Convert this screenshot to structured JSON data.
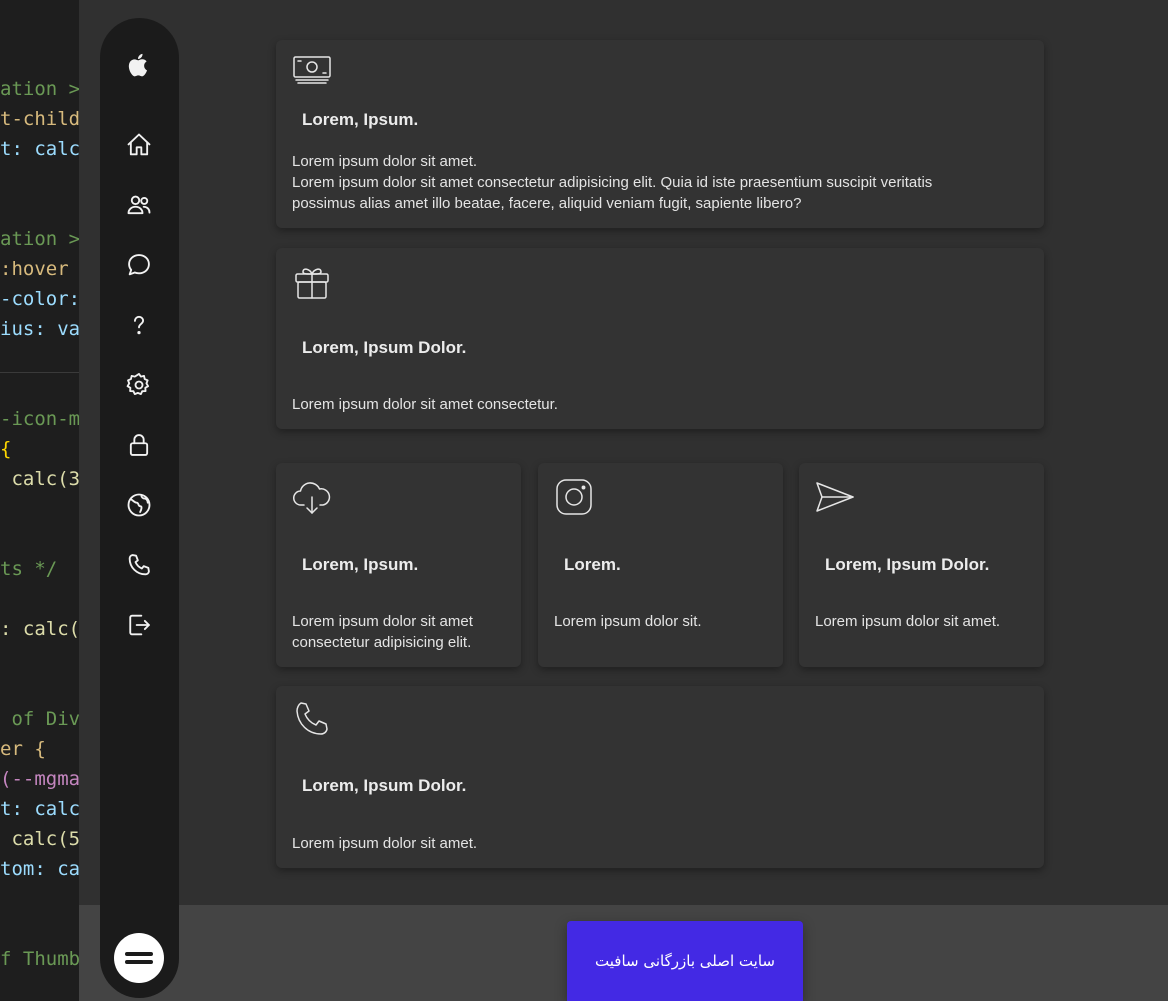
{
  "editor": {
    "lines": [
      {
        "text": "ation > ",
        "color": "#6a9955"
      },
      {
        "text": "t-child",
        "color": "#d7ba7d"
      },
      {
        "text": "t: calc",
        "color": "#9cdcfe"
      },
      {
        "text": "ation > ",
        "color": "#6a9955"
      },
      {
        "text": ":hover ",
        "color": "#d7ba7d"
      },
      {
        "text": "-color:",
        "color": "#9cdcfe"
      },
      {
        "text": "ius: va",
        "color": "#9cdcfe"
      },
      {
        "text": "-icon-m",
        "color": "#6a9955"
      },
      {
        "text": "{",
        "color": "#ffd700"
      },
      {
        "text": " calc(3",
        "color": "#dcdcaa"
      },
      {
        "text": "ts */",
        "color": "#6a9955"
      },
      {
        "text": ": calc(",
        "color": "#dcdcaa"
      },
      {
        "text": " of Div",
        "color": "#6a9955"
      },
      {
        "text": "er {",
        "color": "#d7ba7d"
      },
      {
        "text": "(--mgma",
        "color": "#c586c0"
      },
      {
        "text": "t: calc",
        "color": "#9cdcfe"
      },
      {
        "text": " calc(5",
        "color": "#dcdcaa"
      },
      {
        "text": "tom: ca",
        "color": "#9cdcfe"
      },
      {
        "text": "f Thumb",
        "color": "#6a9955"
      }
    ]
  },
  "sidebar": {
    "icons": [
      "apple-icon",
      "home-icon",
      "users-icon",
      "chat-icon",
      "help-icon",
      "settings-icon",
      "lock-icon",
      "globe-icon",
      "phone-icon",
      "logout-icon"
    ],
    "toggle_icon": "hamburger-icon"
  },
  "cards": [
    {
      "icon": "money-icon",
      "title": "Lorem, Ipsum.",
      "text_line1": "Lorem ipsum dolor sit amet.",
      "text_line2": "Lorem ipsum dolor sit amet consectetur adipisicing elit. Quia id iste praesentium suscipit veritatis possimus alias amet illo beatae, facere, aliquid veniam fugit, sapiente libero?"
    },
    {
      "icon": "gift-icon",
      "title": "Lorem, Ipsum Dolor.",
      "text": "Lorem ipsum dolor sit amet consectetur."
    },
    {
      "icon": "cloud-download-icon",
      "title": "Lorem, Ipsum.",
      "text": "Lorem ipsum dolor sit amet consectetur adipisicing elit."
    },
    {
      "icon": "instagram-icon",
      "title": "Lorem.",
      "text": "Lorem ipsum dolor sit."
    },
    {
      "icon": "send-icon",
      "title": "Lorem, Ipsum Dolor.",
      "text": "Lorem ipsum dolor sit amet."
    },
    {
      "icon": "phone-icon",
      "title": "Lorem, Ipsum Dolor.",
      "text": "Lorem ipsum dolor sit amet."
    }
  ],
  "cta": {
    "label": "سایت اصلی بازرگانی سافیت"
  },
  "colors": {
    "accent": "#4329e4",
    "background": "#303030",
    "card": "#333333",
    "sidebar": "#1b1b1b"
  }
}
